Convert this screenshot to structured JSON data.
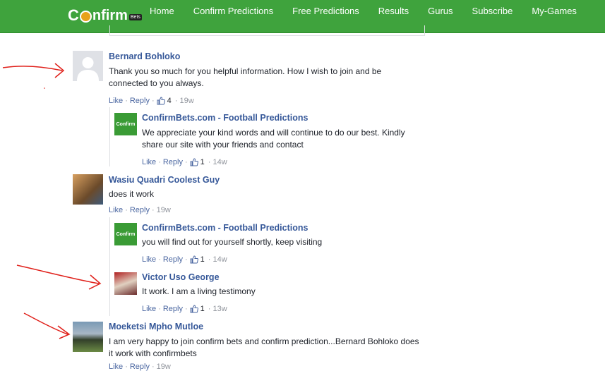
{
  "nav": {
    "logo_text": "nfirm",
    "logo_c": "C",
    "logo_tag": "Bets",
    "items": [
      "Home",
      "Confirm Predictions",
      "Free Predictions",
      "Results",
      "Gurus",
      "Subscribe",
      "My-Games"
    ]
  },
  "comments": {
    "c1": {
      "author": "Bernard Bohloko",
      "text": "Thank you so much for you helpful information. How I wish to join and be connected to you always.",
      "like": "Like",
      "reply": "Reply",
      "likes": "4",
      "time": "19w"
    },
    "r1": {
      "author": "ConfirmBets.com - Football Predictions",
      "text": "We appreciate your kind words and will continue to do our best. Kindly share our site with your friends and contact",
      "like": "Like",
      "reply": "Reply",
      "likes": "1",
      "time": "14w",
      "avatar_text": "Confirm"
    },
    "c2": {
      "author": "Wasiu Quadri Coolest Guy",
      "text": "does it work",
      "like": "Like",
      "reply": "Reply",
      "time": "19w"
    },
    "r2": {
      "author": "ConfirmBets.com - Football Predictions",
      "text": "you will find out for yourself shortly, keep visiting",
      "like": "Like",
      "reply": "Reply",
      "likes": "1",
      "time": "14w",
      "avatar_text": "Confirm"
    },
    "r3": {
      "author": "Victor Uso George",
      "text": "It work. I am a living testimony",
      "like": "Like",
      "reply": "Reply",
      "likes": "1",
      "time": "13w"
    },
    "c3": {
      "author": "Moeketsi Mpho Mutloe",
      "text": "I am very happy to join confirm bets and confirm prediction...Bernard Bohloko does it work with confirmbets",
      "like": "Like",
      "reply": "Reply",
      "time": "19w"
    }
  },
  "colors": {
    "nav_bg": "#3fa33d",
    "author": "#365899",
    "annotation_red": "#e0201a"
  }
}
